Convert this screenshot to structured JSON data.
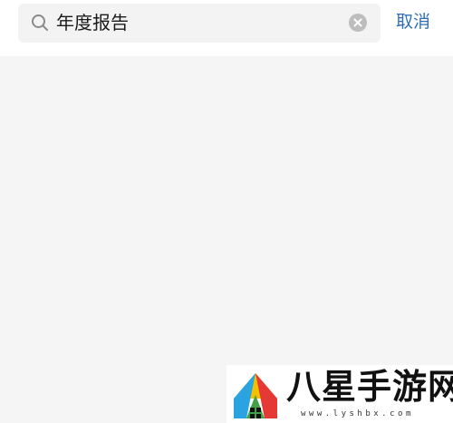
{
  "search": {
    "value": "年度报告",
    "icon": "search-icon",
    "clear_icon": "clear-icon"
  },
  "header": {
    "cancel_label": "取消"
  },
  "watermark": {
    "name": "八星手游网",
    "url": "www.lyshbx.com"
  },
  "colors": {
    "accent": "#2f6fb5",
    "background": "#f5f5f5"
  }
}
